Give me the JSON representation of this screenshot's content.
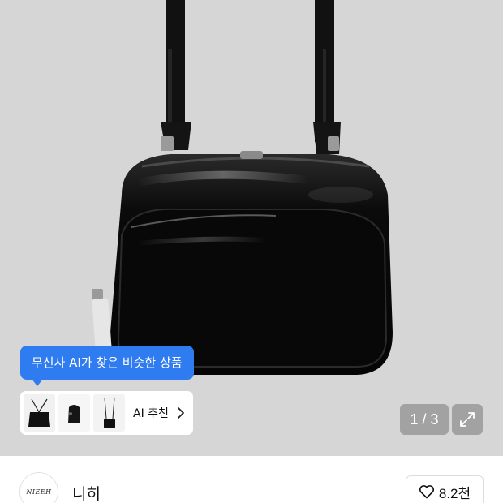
{
  "hero": {
    "tooltip": "무신사 AI가 찾은 비슷한 상품",
    "ai_strip_label": "AI 추천",
    "page_counter": "1 / 3"
  },
  "brand": {
    "logo_text": "NIEEH",
    "name": "니히",
    "like_count": "8.2천"
  },
  "icons": {
    "chevron": "chevron-right-icon",
    "expand": "expand-icon",
    "heart": "heart-outline-icon"
  }
}
